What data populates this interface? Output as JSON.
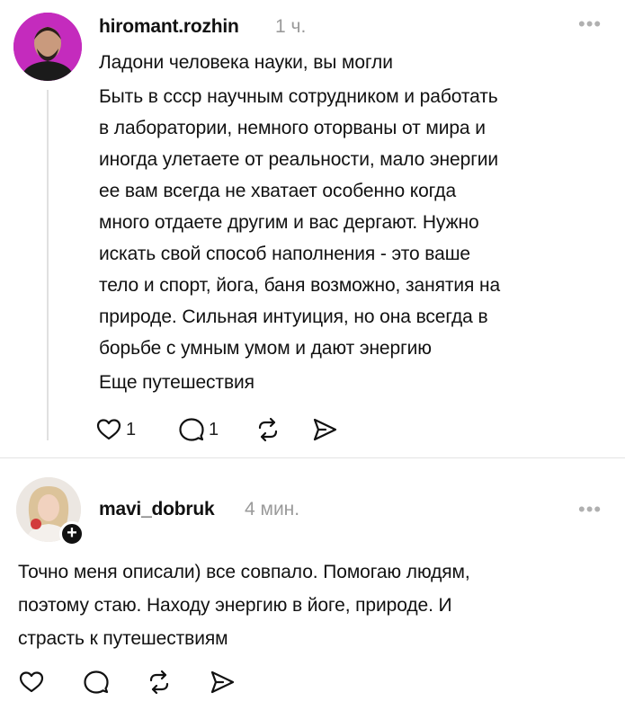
{
  "posts": [
    {
      "username": "hiromant.rozhin",
      "time": "1 ч.",
      "lines": [
        "Ладони человека науки, вы могли",
        "Быть в ссср научным сотрудником и работать",
        "в лаборатории, немного оторваны от мира и",
        "иногда улетаете от реальности, мало энергии",
        "ее вам всегда не хватает особенно когда",
        "много отдаете другим и вас дергают. Нужно",
        "искать свой способ наполнения - это ваше",
        "тело и спорт, йога, баня возможно, занятия на",
        "природе. Сильная интуиция, но она всегда в",
        "борьбе с умным умом и дают энергию",
        "Еще путешествия"
      ],
      "likes": "1",
      "replies": "1"
    },
    {
      "username": "mavi_dobruk",
      "time": "4 мин.",
      "lines": [
        "Точно меня описали) все совпало. Помогаю людям,",
        "поэтому стаю. Находу энергию в йоге, природе. И",
        "страсть к путешествиям"
      ]
    }
  ],
  "ui": {
    "more_glyph": "•••",
    "follow_glyph": "+"
  },
  "icons": [
    "heart-icon",
    "comment-icon",
    "repost-icon",
    "share-icon",
    "more-icon",
    "follow-plus-icon"
  ],
  "colors": {
    "text": "#111111",
    "muted": "#9a9a9a",
    "avatar1_bg": "#c42bbd"
  }
}
